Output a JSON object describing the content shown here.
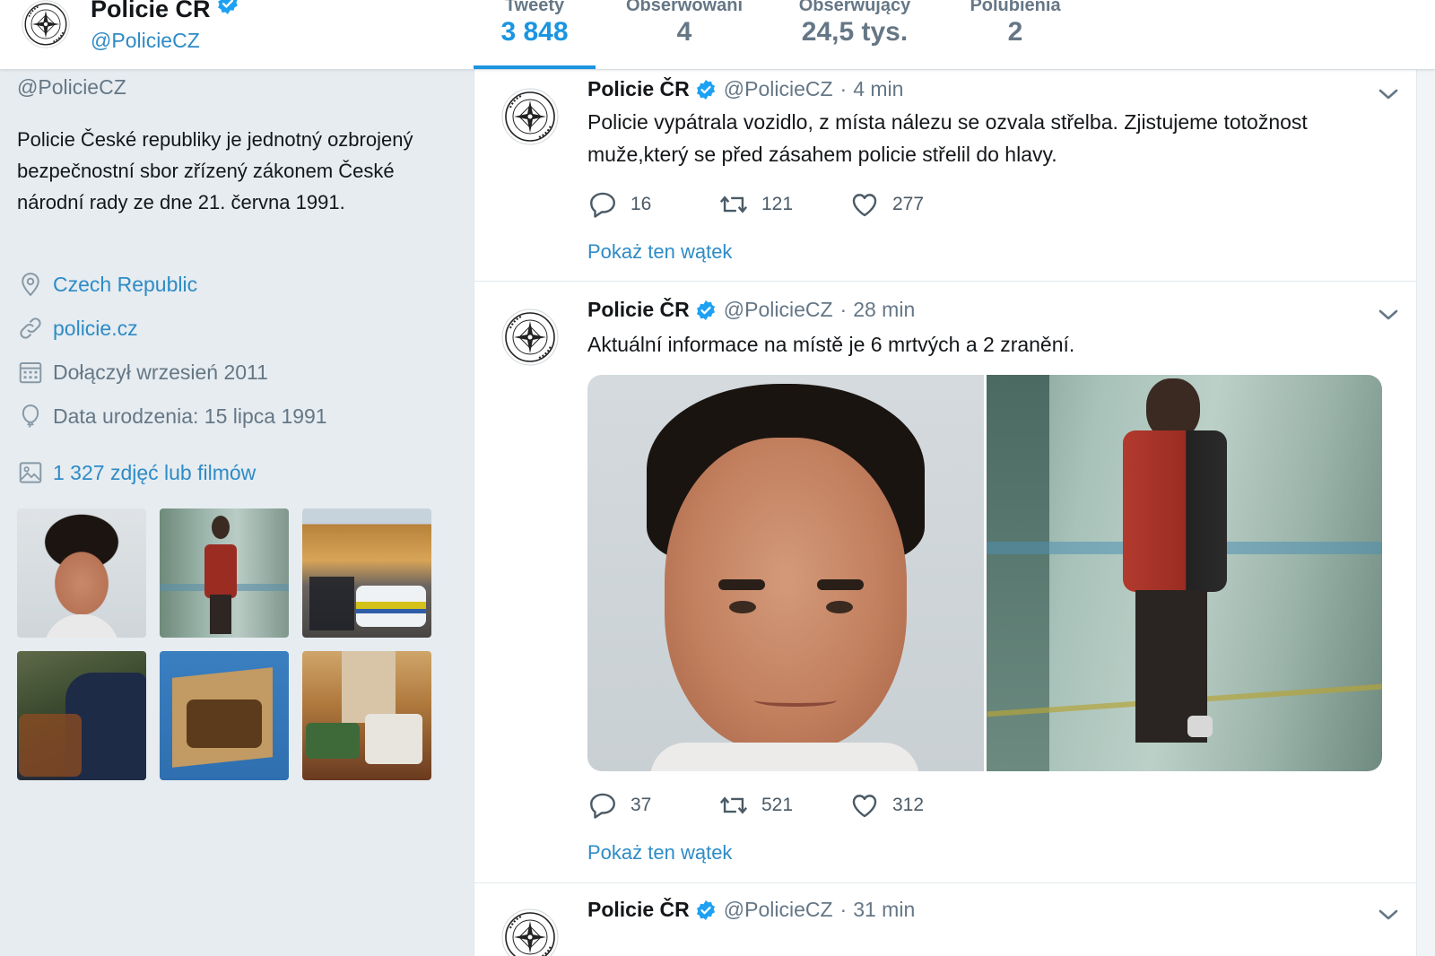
{
  "profile": {
    "name": "Policie ČR",
    "handle": "@PolicieCZ",
    "verified_icon": "verified-badge-icon",
    "bio": "Policie České republiky je jednotný ozbrojený bezpečnostní sbor zřízený zákonem České národní rady ze dne 21. června 1991.",
    "location": "Czech Republic",
    "website": "policie.cz",
    "joined": "Dołączył wrzesień 2011",
    "birthday": "Data urodzenia: 15 lipca 1991",
    "media_link": "1 327 zdjęć lub filmów"
  },
  "stats": [
    {
      "label": "Tweety",
      "value": "3 848",
      "active": true
    },
    {
      "label": "Obserwowani",
      "value": "4",
      "active": false
    },
    {
      "label": "Obserwujący",
      "value": "24,5 tys.",
      "active": false
    },
    {
      "label": "Polubienia",
      "value": "2",
      "active": false
    }
  ],
  "tweets": [
    {
      "name": "Policie ČR",
      "handle": "@PolicieCZ",
      "dot": "·",
      "time": "4 min",
      "text": "Policie vypátrala vozidlo, z místa nálezu se ozvala střelba. Zjistujeme totožnost muže,který se před zásahem  policie střelil do hlavy.",
      "replies": "16",
      "retweets": "121",
      "likes": "277",
      "thread_link": "Pokaż ten wątek"
    },
    {
      "name": "Policie ČR",
      "handle": "@PolicieCZ",
      "dot": "·",
      "time": "28 min",
      "text": "Aktuální informace na místě je 6 mrtvých a 2 zranění.",
      "replies": "37",
      "retweets": "521",
      "likes": "312",
      "thread_link": "Pokaż ten wątek"
    },
    {
      "name": "Policie ČR",
      "handle": "@PolicieCZ",
      "dot": "·",
      "time": "31 min"
    }
  ],
  "colors": {
    "accent": "#1b95e0",
    "link": "#2e8bc6",
    "background": "#e6ecf0",
    "muted": "#657786"
  },
  "icons": [
    "police-badge-avatar",
    "verified-badge-icon",
    "location-pin-icon",
    "link-icon",
    "calendar-icon",
    "balloon-icon",
    "image-icon",
    "reply-icon",
    "retweet-icon",
    "like-icon",
    "chevron-down-icon"
  ]
}
